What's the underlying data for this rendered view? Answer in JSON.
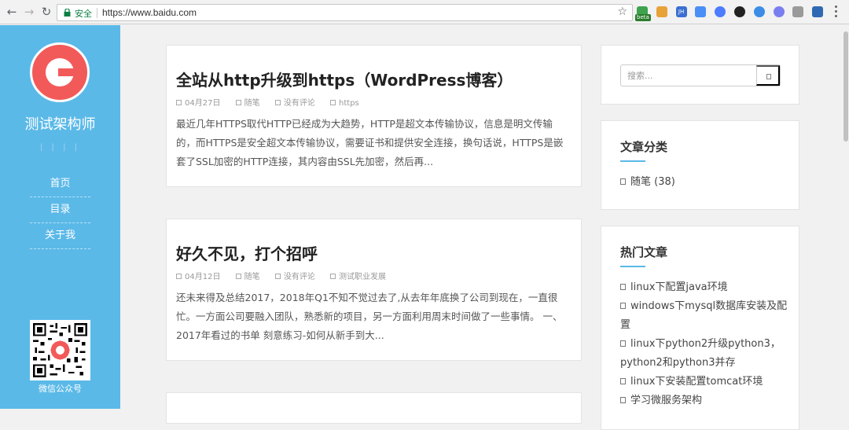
{
  "browser": {
    "back_glyph": "←",
    "forward_glyph": "→",
    "reload_glyph": "↻",
    "secure_label": "安全",
    "url": "https://www.baidu.com",
    "bookmark_glyph": "☆",
    "beta_label": "beta",
    "extension_icons": [
      {
        "name": "evernote-icon",
        "color": "#3fa34d"
      },
      {
        "name": "cookie-icon",
        "color": "#e8a23a"
      },
      {
        "name": "jh-icon",
        "color": "#3b6fd1",
        "text": "JH"
      },
      {
        "name": "translate-icon",
        "color": "#4a8ff5"
      },
      {
        "name": "shield-ext-icon",
        "color": "#4d7cfe"
      },
      {
        "name": "k-ext-icon",
        "color": "#222222"
      },
      {
        "name": "link-ext-icon",
        "color": "#3c8de6"
      },
      {
        "name": "chrome-ext-icon",
        "color": "#7a7ff0"
      },
      {
        "name": "screenshot-ext-icon",
        "color": "#9a9a9a"
      },
      {
        "name": "vpn-ext-icon",
        "color": "#2f69b3"
      }
    ]
  },
  "sidebar": {
    "site_title": "测试架构师",
    "tagline": "| |  | |",
    "nav": [
      {
        "label": "首页"
      },
      {
        "label": "目录"
      },
      {
        "label": "关于我"
      }
    ],
    "qr_caption": "微信公众号",
    "accent_color": "#5bb9e8",
    "logo_color": "#f25a5a"
  },
  "posts": [
    {
      "title": "全站从http升级到https（WordPress博客）",
      "date": "04月27日",
      "category": "随笔",
      "comments": "没有评论",
      "tag": "https",
      "excerpt": "最近几年HTTPS取代HTTP已经成为大趋势，HTTP是超文本传输协议，信息是明文传输的，而HTTPS是安全超文本传输协议，需要证书和提供安全连接，换句话说，HTTPS是嵌套了SSL加密的HTTP连接，其内容由SSL先加密，然后再..."
    },
    {
      "title": "好久不见，打个招呼",
      "date": "04月12日",
      "category": "随笔",
      "comments": "没有评论",
      "tag": "测试职业发展",
      "excerpt": "还未来得及总结2017，2018年Q1不知不觉过去了,从去年年底换了公司到现在，一直很忙。一方面公司要融入团队，熟悉新的项目，另一方面利用周末时间做了一些事情。 一、2017年看过的书单 刻意练习-如何从新手到大..."
    }
  ],
  "search": {
    "placeholder": "搜索..."
  },
  "categories_widget": {
    "title": "文章分类",
    "items": [
      {
        "label": "随笔 (38)"
      }
    ]
  },
  "hot_widget": {
    "title": "热门文章",
    "items": [
      {
        "label": "linux下配置java环境"
      },
      {
        "label": "windows下mysql数据库安装及配置"
      },
      {
        "label": "linux下python2升级python3，python2和python3并存"
      },
      {
        "label": "linux下安装配置tomcat环境"
      },
      {
        "label": "学习微服务架构"
      }
    ]
  }
}
